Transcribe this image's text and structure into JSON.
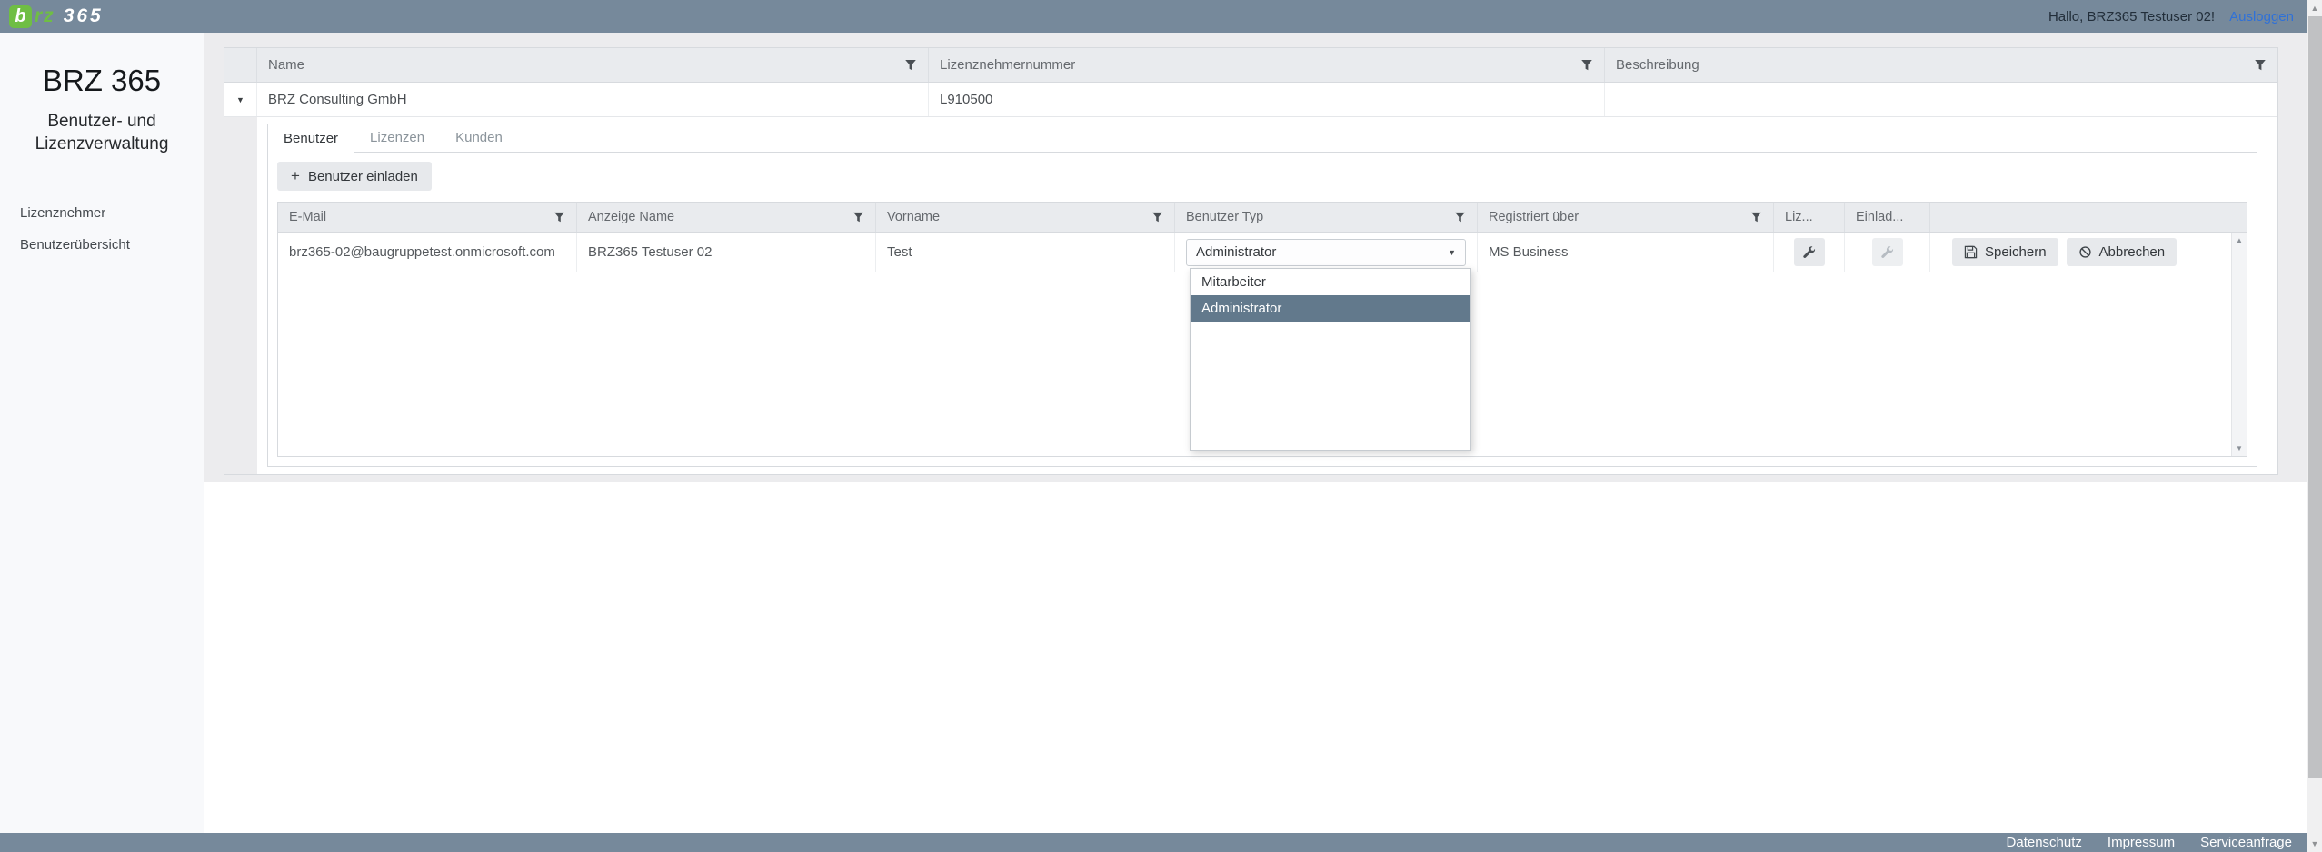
{
  "topbar": {
    "logo": {
      "b": "b",
      "rz": "rz",
      "suffix": "365"
    },
    "greeting": "Hallo, BRZ365 Testuser 02!",
    "logout_label": "Ausloggen"
  },
  "sidebar": {
    "title": "BRZ 365",
    "subtitle": "Benutzer- und Lizenzverwaltung",
    "items": [
      {
        "label": "Lizenznehmer"
      },
      {
        "label": "Benutzerübersicht"
      }
    ]
  },
  "licensee_grid": {
    "columns": [
      {
        "label": "Name"
      },
      {
        "label": "Lizenznehmernummer"
      },
      {
        "label": "Beschreibung"
      }
    ],
    "row": {
      "name": "BRZ Consulting GmbH",
      "number": "L910500",
      "description": ""
    }
  },
  "detail": {
    "tabs": [
      {
        "label": "Benutzer",
        "active": true
      },
      {
        "label": "Lizenzen",
        "active": false
      },
      {
        "label": "Kunden",
        "active": false
      }
    ],
    "invite_button": {
      "icon": "+",
      "label": "Benutzer einladen"
    }
  },
  "user_grid": {
    "columns": [
      {
        "label": "E-Mail"
      },
      {
        "label": "Anzeige Name"
      },
      {
        "label": "Vorname"
      },
      {
        "label": "Benutzer Typ"
      },
      {
        "label": "Registriert über"
      },
      {
        "label": "Liz..."
      },
      {
        "label": "Einlad..."
      }
    ],
    "row": {
      "email": "brz365-02@baugruppetest.onmicrosoft.com",
      "display_name": "BRZ365 Testuser 02",
      "first_name": "Test",
      "user_type": "Administrator",
      "registered_via": "MS Business"
    },
    "actions": {
      "save_label": "Speichern",
      "cancel_label": "Abbrechen"
    }
  },
  "user_type_dropdown": {
    "value": "Administrator",
    "options": [
      {
        "label": "Mitarbeiter",
        "selected": false
      },
      {
        "label": "Administrator",
        "selected": true
      }
    ]
  },
  "footer": {
    "links": [
      {
        "label": "Datenschutz"
      },
      {
        "label": "Impressum"
      },
      {
        "label": "Serviceanfrage"
      }
    ]
  },
  "icons": {
    "plus": "+",
    "expand_arrow": "▼",
    "dropdown_arrow": "▼",
    "scroll_up": "▲",
    "scroll_down": "▼",
    "filter": "funnel-svg",
    "wrench": "wrench-svg",
    "save": "floppy-svg",
    "cancel": "circle-slash-svg"
  },
  "colors": {
    "bar": "#76899b",
    "brand_green": "#6fbe44",
    "link_blue": "#2f71d8",
    "selected_item_bg": "#62798c",
    "grid_header_bg": "#e9ebee"
  }
}
